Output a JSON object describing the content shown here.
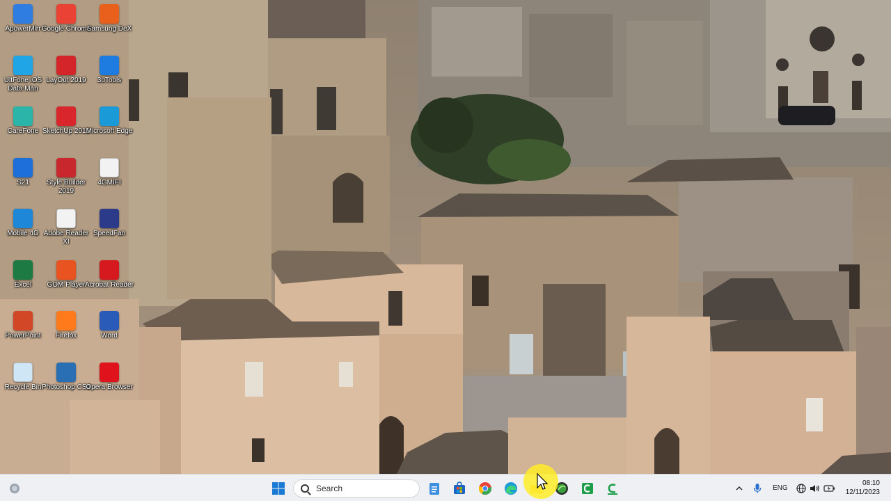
{
  "desktop": {
    "icons": [
      {
        "label": "ApowerMirr",
        "icon": "apowermirror-icon",
        "color": "#2f7de1"
      },
      {
        "label": "Google Chrome",
        "icon": "chrome-icon",
        "color": "#ea4335"
      },
      {
        "label": "Samsung DeX",
        "icon": "samsung-dex-icon",
        "color": "#e8601c"
      },
      {
        "label": "UltFone iOS Data Man",
        "icon": "ultfone-icon",
        "color": "#20a6e6"
      },
      {
        "label": "LayOut 2019",
        "icon": "layout-icon",
        "color": "#d4252a"
      },
      {
        "label": "3uTools",
        "icon": "3utools-icon",
        "color": "#1e7be0"
      },
      {
        "label": "CareFone",
        "icon": "carefone-icon",
        "color": "#2bb5a8"
      },
      {
        "label": "SketchUp 2019",
        "icon": "sketchup-icon",
        "color": "#d8262c"
      },
      {
        "label": "Microsoft Edge",
        "icon": "edge-icon",
        "color": "#1a9bd7"
      },
      {
        "label": "S21",
        "icon": "s21-icon",
        "color": "#1e6fd9"
      },
      {
        "label": "Style Builder 2019",
        "icon": "style-builder-icon",
        "color": "#c8282d"
      },
      {
        "label": "4GMIFI",
        "icon": "document-icon",
        "color": "#f2f2f2"
      },
      {
        "label": "Mobile 4G",
        "icon": "globe-icon",
        "color": "#1f87d8"
      },
      {
        "label": "Adobe Reader XI",
        "icon": "document-icon",
        "color": "#f2f2f2"
      },
      {
        "label": "SpeedFan",
        "icon": "speedfan-icon",
        "color": "#2c3a8a"
      },
      {
        "label": "Excel",
        "icon": "excel-icon",
        "color": "#1d7a43"
      },
      {
        "label": "GOM Player",
        "icon": "gom-player-icon",
        "color": "#e9531f"
      },
      {
        "label": "Acrobat Reader",
        "icon": "acrobat-icon",
        "color": "#d5191f"
      },
      {
        "label": "PowerPoint",
        "icon": "powerpoint-icon",
        "color": "#d24726"
      },
      {
        "label": "Firefox",
        "icon": "firefox-icon",
        "color": "#ff7a1a"
      },
      {
        "label": "Word",
        "icon": "word-icon",
        "color": "#2a5bb8"
      },
      {
        "label": "Recycle Bin",
        "icon": "recycle-bin-icon",
        "color": "#cfe6f6"
      },
      {
        "label": "Photoshop CS4",
        "icon": "photoshop-icon",
        "color": "#2a6fb3"
      },
      {
        "label": "Opera Browser",
        "icon": "opera-icon",
        "color": "#e0131d"
      }
    ]
  },
  "taskbar": {
    "search_placeholder": "Search",
    "pinned": [
      {
        "icon": "windows-start-icon",
        "color": "#1a7ad4"
      },
      {
        "icon": "notepad-icon",
        "color": "#3d8fe0"
      },
      {
        "icon": "microsoft-store-icon",
        "color": "#1d63c4"
      },
      {
        "icon": "chrome-icon",
        "color": "#ea4335"
      },
      {
        "icon": "edge-icon",
        "color": "#1a9bd7"
      },
      {
        "icon": "file-explorer-icon",
        "color": "#f5c23a"
      },
      {
        "icon": "app-icon-green-sphere",
        "color": "#3aa03c"
      },
      {
        "icon": "camtasia-icon",
        "color": "#1e9e4a"
      },
      {
        "icon": "camtasia-recorder-icon",
        "color": "#1e9e4a"
      }
    ],
    "tray": {
      "language": "ENG",
      "time": "08:10",
      "date": "12/11/2023"
    }
  }
}
